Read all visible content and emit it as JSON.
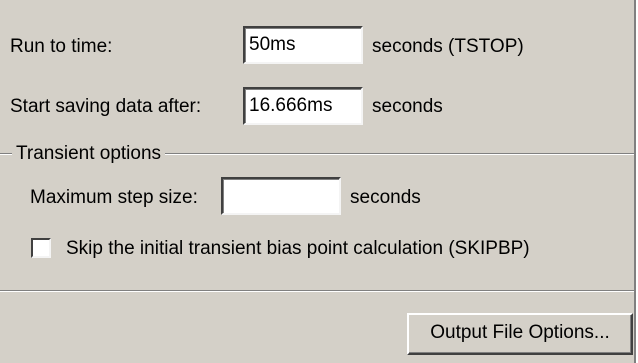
{
  "run_to_time": {
    "label": "Run to time:",
    "value": "50ms",
    "unit": "seconds  (TSTOP)"
  },
  "start_saving": {
    "label": "Start saving data after:",
    "value": "16.666ms",
    "unit": "seconds"
  },
  "transient_options": {
    "group_label": "Transient options",
    "max_step": {
      "label": "Maximum step size:",
      "value": "",
      "unit": "seconds"
    },
    "skip_bias": {
      "label": "Skip the initial transient bias point calculation  (SKIPBP)",
      "checked": false
    }
  },
  "output_file_options_button": "Output File Options..."
}
